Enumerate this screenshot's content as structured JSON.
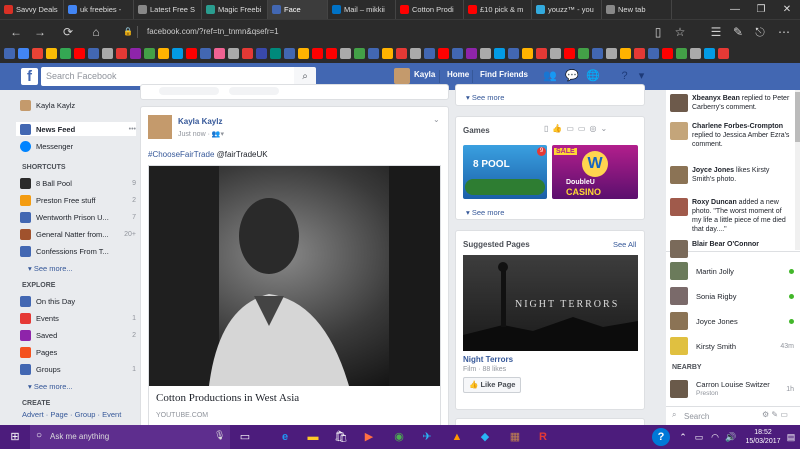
{
  "browser": {
    "tabs": [
      {
        "title": "Savvy Deals",
        "icon_color": "#d93025"
      },
      {
        "title": "uk freebies -",
        "icon_color": "#4285f4"
      },
      {
        "title": "Latest Free S",
        "icon_color": "#888888"
      },
      {
        "title": "Magic Freebi",
        "icon_color": "#2a9d8f"
      },
      {
        "title": "Face",
        "icon_color": "#4267b2"
      },
      {
        "title": "Mail – mikkii",
        "icon_color": "#0072c6"
      },
      {
        "title": "Cotton Prodi",
        "icon_color": "#ff0000"
      },
      {
        "title": "£10 pick & m",
        "icon_color": "#ff0000"
      },
      {
        "title": "youzz™ - you",
        "icon_color": "#33aadd"
      },
      {
        "title": "New tab",
        "icon_color": "#888888"
      }
    ],
    "window_controls": [
      "—",
      "❐",
      "✕"
    ],
    "url": "facebook.com/?ref=tn_tnmn&qsefr=1",
    "bookmark_colors": [
      "#4267b2",
      "#4285f4",
      "#ea4335",
      "#fbbc05",
      "#34a853",
      "#ff0000",
      "#4267b2",
      "#aaaaaa",
      "#e53935",
      "#8e24aa",
      "#43a047",
      "#ffb300",
      "#039be5",
      "#ff0000",
      "#4267b2",
      "#f06292",
      "#aaaaaa",
      "#e53935",
      "#3949ab",
      "#00897b",
      "#4267b2",
      "#ffb300",
      "#ff0000",
      "#ff0000",
      "#aaaaaa",
      "#43a047",
      "#4267b2",
      "#ffb300",
      "#e53935",
      "#aaaaaa",
      "#4267b2",
      "#ff0000",
      "#4267b2",
      "#8e24aa",
      "#aaaaaa",
      "#039be5",
      "#4267b2",
      "#ffb300",
      "#e53935",
      "#aaaaaa",
      "#ff0000",
      "#43a047",
      "#4267b2",
      "#aaaaaa",
      "#ffb300",
      "#e53935",
      "#4267b2",
      "#ff0000",
      "#43a047",
      "#aaaaaa",
      "#039be5",
      "#e53935"
    ]
  },
  "fb": {
    "search_placeholder": "Search Facebook",
    "user": "Kayla",
    "home": "Home",
    "find_friends": "Find Friends"
  },
  "left": {
    "profile": "Kayla Kaylz",
    "news_feed": "News Feed",
    "messenger": "Messenger",
    "shortcuts_header": "SHORTCUTS",
    "shortcuts": [
      {
        "label": "8 Ball Pool",
        "count": "9",
        "color": "#2b2b2b"
      },
      {
        "label": "Preston Free stuff",
        "count": "2",
        "color": "#f39c12"
      },
      {
        "label": "Wentworth Prison U...",
        "count": "7",
        "color": "#4267b2"
      },
      {
        "label": "General Natter from...",
        "count": "20+",
        "color": "#a0522d"
      },
      {
        "label": "Confessions From T...",
        "count": "",
        "color": "#4267b2"
      }
    ],
    "see_more_1": "See more...",
    "explore_header": "EXPLORE",
    "explore": [
      {
        "label": "On this Day",
        "count": "",
        "color": "#4267b2"
      },
      {
        "label": "Events",
        "count": "1",
        "color": "#e53935"
      },
      {
        "label": "Saved",
        "count": "2",
        "color": "#8e24aa"
      },
      {
        "label": "Pages",
        "count": "",
        "color": "#f4511e"
      },
      {
        "label": "Groups",
        "count": "1",
        "color": "#4267b2"
      }
    ],
    "see_more_2": "See more...",
    "create_header": "CREATE",
    "create_links": [
      "Advert",
      "Page",
      "Group",
      "Event"
    ]
  },
  "post": {
    "author": "Kayla Kaylz",
    "time": "Just now",
    "hashtag": "#ChooseFairTrade",
    "mention": "@fairTradeUK",
    "link_title": "Cotton Productions in West Asia",
    "link_domain": "YOUTUBE.COM"
  },
  "rightmid": {
    "see_more_top": "See more",
    "games_header": "Games",
    "game1": "8 POOL",
    "game1_badge": "9",
    "game2_sale": "SALE",
    "game2_top": "DoubleU",
    "game2_bottom": "CASINO",
    "see_more_games": "See more",
    "suggested_header": "Suggested Pages",
    "see_all": "See All",
    "page_image_text": "Night Terrors",
    "page_name": "Night Terrors",
    "page_meta": "Film · 88 likes",
    "like_page": "Like Page"
  },
  "chat": {
    "notifications": [
      {
        "name": "Xbeanyx Bean",
        "text": " replied to Peter Carberry's comment.",
        "color": "#6d5a4b"
      },
      {
        "name": "Charlene Forbes-Crompton",
        "text": " replied to Jessica Amber Ezra's comment.",
        "color": "#c4a57a"
      },
      {
        "name": "Joyce Jones",
        "text": " likes Kirsty Smith's photo.",
        "color": "#8b7355"
      },
      {
        "name": "Roxy Duncan",
        "text": " added a new photo. \"The worst moment of my life a little piece of me died that day....\"",
        "color": "#a05a4b"
      },
      {
        "name": "Blair Bear O'Connor",
        "text": "",
        "color": "#7a6a5a"
      }
    ],
    "contacts": [
      {
        "name": "Martin Jolly",
        "status": "dot",
        "color": "#6b7b5b"
      },
      {
        "name": "Sonia Rigby",
        "status": "dot",
        "color": "#7a6a6a"
      },
      {
        "name": "Joyce Jones",
        "status": "dot",
        "color": "#8b7355"
      },
      {
        "name": "Kirsty Smith",
        "status": "43m",
        "color": "#e0c040"
      }
    ],
    "nearby_header": "NEARBY",
    "nearby": [
      {
        "name": "Carron Louise Switzer",
        "sub": "Preston",
        "status": "1h",
        "color": "#6a5a4a"
      }
    ],
    "search": "Search"
  },
  "taskbar": {
    "cortana": "Ask me anything",
    "time": "18:52",
    "date": "15/03/2017"
  }
}
